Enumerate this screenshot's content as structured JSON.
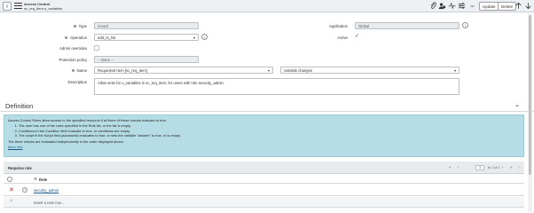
{
  "header": {
    "title": "Access Control",
    "subtitle": "sc_req_item.u_variables",
    "update_label": "Update",
    "delete_label": "Delete",
    "more_label": "•••"
  },
  "form": {
    "type_label": "Type",
    "type_value": "record",
    "operation_label": "Operation",
    "operation_value": "add_to_list",
    "admin_overrides_label": "Admin overrides",
    "protection_policy_label": "Protection policy",
    "protection_policy_value": "-- None --",
    "name_label": "Name",
    "name_table": "Requested Item [sc_req_item]",
    "name_field": "Variable changes",
    "description_label": "Description",
    "description_value": "Allow write for u_variables in sc_req_item, for users with role security_admin.",
    "application_label": "Application",
    "application_value": "Global",
    "active_label": "Active"
  },
  "definition": {
    "heading": "Definition",
    "intro": "Access Control Rules allow access to the specified resource if all three of these checks evaluate to true:",
    "checks": [
      "The user has one of the roles specified in the Role list, or the list is empty.",
      "Conditions in the Condition field evaluate to true, or conditions are empty.",
      "The script in the Script field (advanced) evaluates to true, or sets the variable \"answer\" to true, or is empty."
    ],
    "note": "The three checks are evaluated independently in the order displayed above.",
    "more_info": "More Info"
  },
  "related_list": {
    "title": "Requires role",
    "page_current": "1",
    "page_total": "to 1 of 1",
    "column_role": "Role",
    "rows": [
      {
        "role": "security_admin"
      }
    ],
    "insert_placeholder": "Insert a new row..."
  }
}
